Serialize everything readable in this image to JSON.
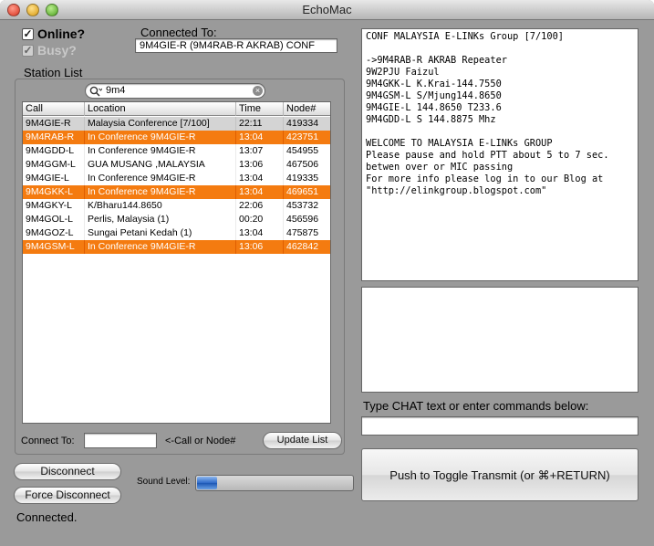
{
  "window": {
    "title": "EchoMac"
  },
  "status": {
    "online_label": "Online?",
    "online_checked": "✓",
    "busy_label": "Busy?",
    "busy_checked": "✓",
    "connected_to_label": "Connected To:",
    "connected_to_value": "9M4GIE-R (9M4RAB-R AKRAB) CONF"
  },
  "station_list": {
    "title": "Station List",
    "search": {
      "value": "9m4",
      "placeholder": ""
    },
    "columns": [
      "Call",
      "Location",
      "Time",
      "Node#"
    ],
    "rows": [
      {
        "call": "9M4GIE-R",
        "location": "Malaysia Conference [7/100]",
        "time": "22:11",
        "node": "419334",
        "style": "selected"
      },
      {
        "call": "9M4RAB-R",
        "location": "In Conference 9M4GIE-R",
        "time": "13:04",
        "node": "423751",
        "style": "orange"
      },
      {
        "call": "9M4GDD-L",
        "location": "In Conference 9M4GIE-R",
        "time": "13:07",
        "node": "454955",
        "style": ""
      },
      {
        "call": "9M4GGM-L",
        "location": "GUA MUSANG ,MALAYSIA",
        "time": "13:06",
        "node": "467506",
        "style": ""
      },
      {
        "call": "9M4GIE-L",
        "location": "In Conference 9M4GIE-R",
        "time": "13:04",
        "node": "419335",
        "style": ""
      },
      {
        "call": "9M4GKK-L",
        "location": "In Conference 9M4GIE-R",
        "time": "13:04",
        "node": "469651",
        "style": "orange"
      },
      {
        "call": "9M4GKY-L",
        "location": "K/Bharu144.8650",
        "time": "22:06",
        "node": "453732",
        "style": ""
      },
      {
        "call": "9M4GOL-L",
        "location": "Perlis, Malaysia (1)",
        "time": "00:20",
        "node": "456596",
        "style": ""
      },
      {
        "call": "9M4GOZ-L",
        "location": "Sungai Petani Kedah  (1)",
        "time": "13:04",
        "node": "475875",
        "style": ""
      },
      {
        "call": "9M4GSM-L",
        "location": "In Conference 9M4GIE-R",
        "time": "13:06",
        "node": "462842",
        "style": "orange"
      }
    ],
    "connect_to_label": "Connect To:",
    "connect_to_value": "",
    "connect_hint": "<-Call or Node#",
    "update_button": "Update List"
  },
  "controls": {
    "disconnect_button": "Disconnect",
    "force_disconnect_button": "Force Disconnect",
    "sound_level_label": "Sound Level:",
    "sound_level": 0.13
  },
  "footer": {
    "status_text": "Connected."
  },
  "info_text": "CONF MALAYSIA E-LINKs Group [7/100]\n\n->9M4RAB-R AKRAB Repeater\n9W2PJU Faizul\n9M4GKK-L K.Krai-144.7550\n9M4GSM-L S/Mjung144.8650\n9M4GIE-L 144.8650 T233.6\n9M4GDD-L S 144.8875 Mhz\n\nWELCOME TO MALAYSIA E-LINKs GROUP\nPlease pause and hold PTT about 5 to 7 sec.\nbetwen over or MIC passing\nFor more info please log in to our Blog at\n\"http://elinkgroup.blogspot.com\"",
  "chat": {
    "log_text": "",
    "prompt_label": "Type CHAT text or enter commands below:",
    "input_value": ""
  },
  "transmit_button": "Push to Toggle Transmit (or ⌘+RETURN)",
  "colors": {
    "highlight_orange": "#f47b10",
    "selection_gray": "#d4d4d4",
    "window_gray": "#9a9a9a"
  }
}
